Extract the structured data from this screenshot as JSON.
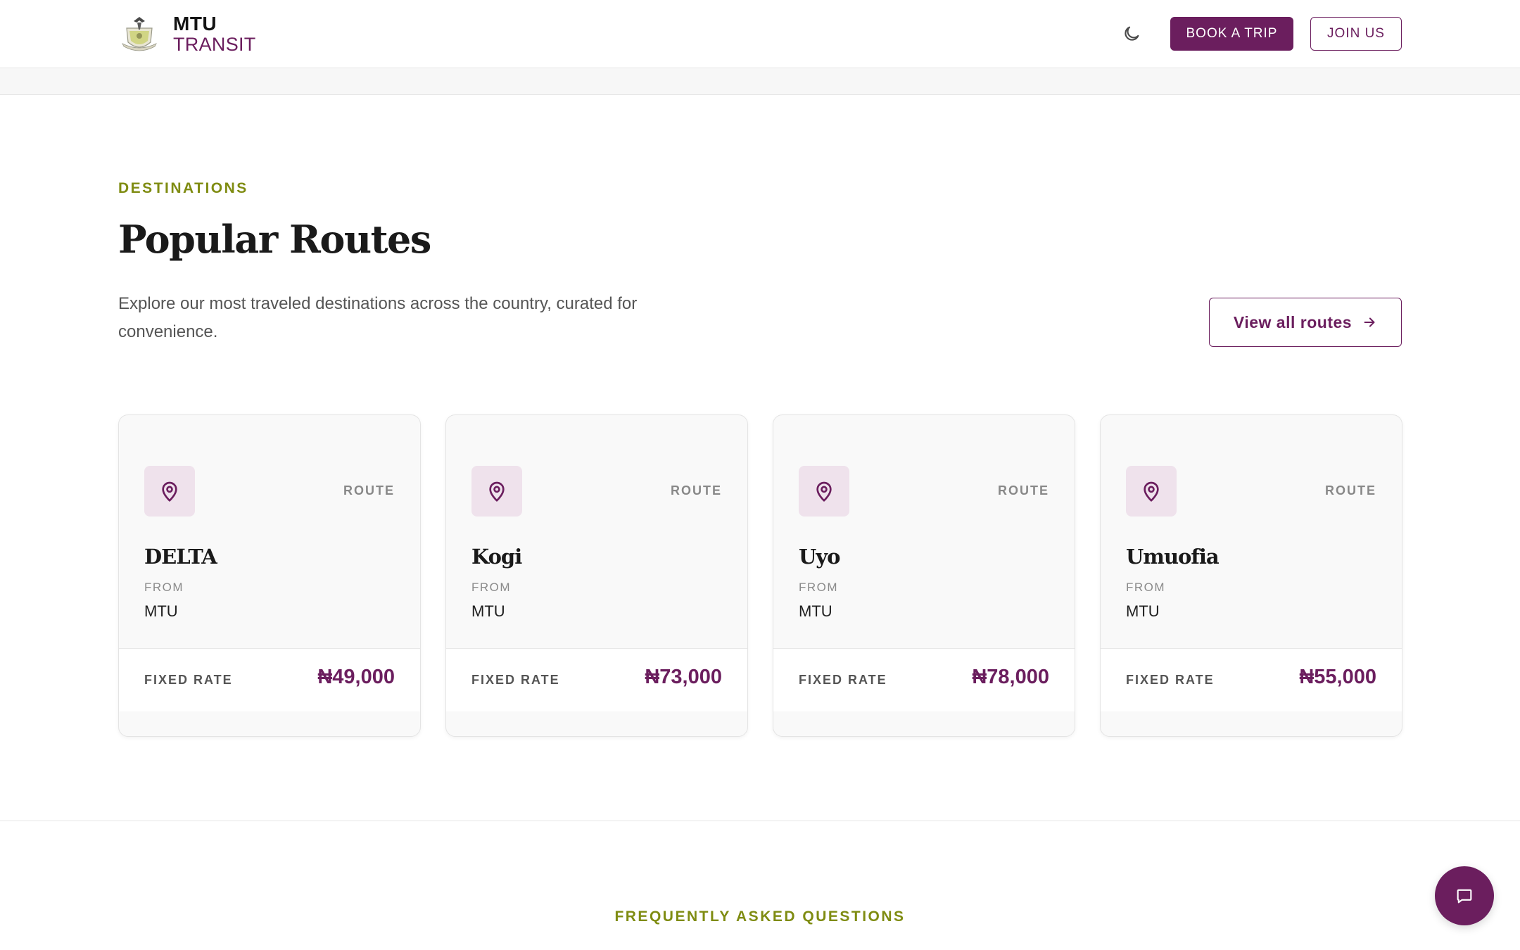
{
  "header": {
    "brand_line1": "MTU",
    "brand_line2": "TRANSIT",
    "theme_toggle_icon": "moon-icon",
    "book_label": "BOOK A TRIP",
    "join_label": "JOIN US"
  },
  "colors": {
    "brand": "#6b1e5e",
    "accent_olive": "#7f8c12",
    "pin_bg": "#efe2ec"
  },
  "section": {
    "eyebrow": "DESTINATIONS",
    "title": "Popular Routes",
    "description": "Explore our most traveled destinations across the country, curated for convenience.",
    "view_all_label": "View all routes",
    "view_all_icon": "arrow-right-icon"
  },
  "routes": [
    {
      "tag": "ROUTE",
      "destination": "DELTA",
      "from_label": "FROM",
      "from": "MTU",
      "rate_label": "FIXED RATE",
      "price": "₦49,000",
      "icon": "map-pin-icon"
    },
    {
      "tag": "ROUTE",
      "destination": "Kogi",
      "from_label": "FROM",
      "from": "MTU",
      "rate_label": "FIXED RATE",
      "price": "₦73,000",
      "icon": "map-pin-icon"
    },
    {
      "tag": "ROUTE",
      "destination": "Uyo",
      "from_label": "FROM",
      "from": "MTU",
      "rate_label": "FIXED RATE",
      "price": "₦78,000",
      "icon": "map-pin-icon"
    },
    {
      "tag": "ROUTE",
      "destination": "Umuofia",
      "from_label": "FROM",
      "from": "MTU",
      "rate_label": "FIXED RATE",
      "price": "₦55,000",
      "icon": "map-pin-icon"
    }
  ],
  "faq": {
    "eyebrow": "FREQUENTLY ASKED QUESTIONS"
  },
  "chat": {
    "icon": "chat-bubble-icon"
  }
}
